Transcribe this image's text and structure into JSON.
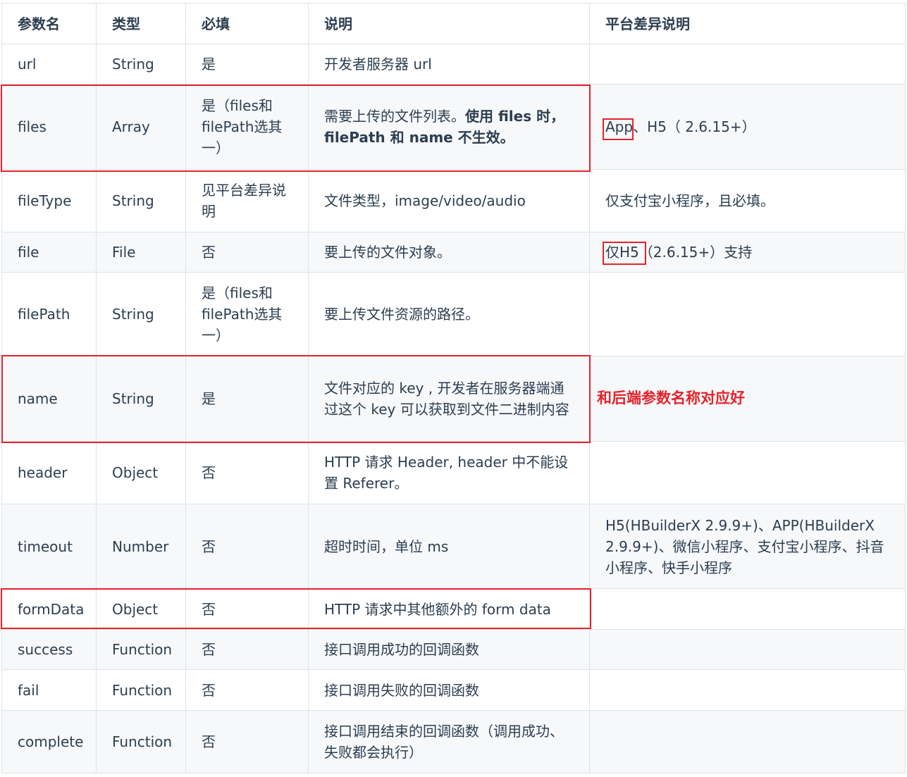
{
  "headers": [
    "参数名",
    "类型",
    "必填",
    "说明",
    "平台差异说明"
  ],
  "rows": [
    {
      "name": "url",
      "type": "String",
      "required": "是",
      "desc": "开发者服务器 url",
      "desc_bold": "",
      "platform": ""
    },
    {
      "name": "files",
      "type": "Array",
      "required": "是（files和filePath选其一）",
      "desc": "需要上传的文件列表。",
      "desc_bold": "使用 files 时，filePath 和 name 不生效。",
      "platform": "App、H5（ 2.6.15+）"
    },
    {
      "name": "fileType",
      "type": "String",
      "required": "见平台差异说明",
      "desc": "文件类型，image/video/audio",
      "desc_bold": "",
      "platform": "仅支付宝小程序，且必填。"
    },
    {
      "name": "file",
      "type": "File",
      "required": "否",
      "desc": "要上传的文件对象。",
      "desc_bold": "",
      "platform": "仅H5（2.6.15+）支持"
    },
    {
      "name": "filePath",
      "type": "String",
      "required": "是（files和filePath选其一）",
      "desc": "要上传文件资源的路径。",
      "desc_bold": "",
      "platform": ""
    },
    {
      "name": "name",
      "type": "String",
      "required": "是",
      "desc": "文件对应的 key , 开发者在服务器端通过这个 key 可以获取到文件二进制内容",
      "desc_bold": "",
      "platform": ""
    },
    {
      "name": "header",
      "type": "Object",
      "required": "否",
      "desc": "HTTP 请求 Header, header 中不能设置 Referer。",
      "desc_bold": "",
      "platform": ""
    },
    {
      "name": "timeout",
      "type": "Number",
      "required": "否",
      "desc": "超时时间，单位 ms",
      "desc_bold": "",
      "platform": "H5(HBuilderX 2.9.9+)、APP(HBuilderX 2.9.9+)、微信小程序、支付宝小程序、抖音小程序、快手小程序"
    },
    {
      "name": "formData",
      "type": "Object",
      "required": "否",
      "desc": "HTTP 请求中其他额外的 form data",
      "desc_bold": "",
      "platform": ""
    },
    {
      "name": "success",
      "type": "Function",
      "required": "否",
      "desc": "接口调用成功的回调函数",
      "desc_bold": "",
      "platform": ""
    },
    {
      "name": "fail",
      "type": "Function",
      "required": "否",
      "desc": "接口调用失败的回调函数",
      "desc_bold": "",
      "platform": ""
    },
    {
      "name": "complete",
      "type": "Function",
      "required": "否",
      "desc": "接口调用结束的回调函数（调用成功、失败都会执行）",
      "desc_bold": "",
      "platform": ""
    }
  ],
  "annotation": "和后端参数名称对应好",
  "highlight_color": "#e5232b"
}
